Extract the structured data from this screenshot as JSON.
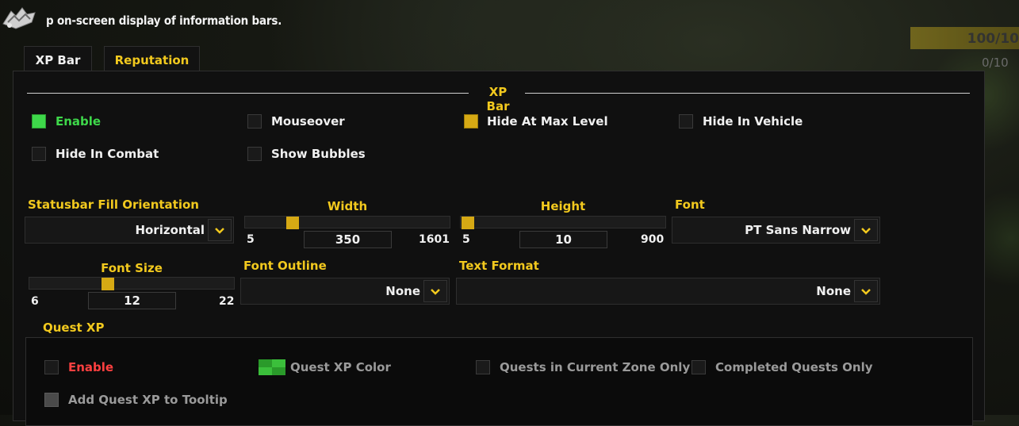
{
  "header": {
    "text": "p on-screen display of information bars."
  },
  "hud": {
    "value_text": "100/10",
    "sub_text": "0/10"
  },
  "tabs": [
    {
      "label": "XP Bar",
      "active": true
    },
    {
      "label": "Reputation",
      "active": false
    }
  ],
  "section": {
    "title": "XP Bar"
  },
  "checkboxes": {
    "enable": {
      "label": "Enable",
      "checked": true
    },
    "mouseover": {
      "label": "Mouseover",
      "checked": false
    },
    "hide_max_level": {
      "label": "Hide At Max Level",
      "checked": true
    },
    "hide_vehicle": {
      "label": "Hide In Vehicle",
      "checked": false
    },
    "hide_combat": {
      "label": "Hide In Combat",
      "checked": false
    },
    "show_bubbles": {
      "label": "Show Bubbles",
      "checked": false
    }
  },
  "orientation": {
    "title": "Statusbar Fill Orientation",
    "value": "Horizontal"
  },
  "width": {
    "title": "Width",
    "min": "5",
    "max": "1601",
    "value": "350",
    "fraction": 0.215
  },
  "height": {
    "title": "Height",
    "min": "5",
    "max": "900",
    "value": "10",
    "fraction": 0.006
  },
  "font": {
    "title": "Font",
    "value": "PT Sans Narrow"
  },
  "font_size": {
    "title": "Font Size",
    "min": "6",
    "max": "22",
    "value": "12",
    "fraction": 0.375
  },
  "font_outline": {
    "title": "Font Outline",
    "value": "None"
  },
  "text_format": {
    "title": "Text Format",
    "value": "None"
  },
  "quest_xp": {
    "title": "Quest XP",
    "enable": {
      "label": "Enable",
      "checked": false
    },
    "color": {
      "label": "Quest XP Color",
      "swatch": "#3bbf3b"
    },
    "current_zone": {
      "label": "Quests in Current Zone Only",
      "checked": false
    },
    "completed": {
      "label": "Completed Quests Only",
      "checked": false
    },
    "tooltip": {
      "label": "Add Quest XP to Tooltip",
      "checked": false
    }
  },
  "icons": {
    "dropdown": "chevron-down-icon",
    "logo": "addon-logo-icon"
  },
  "colors": {
    "accent": "#f2c91e",
    "enabled": "#3ed84a",
    "disabled": "#ff4040"
  }
}
